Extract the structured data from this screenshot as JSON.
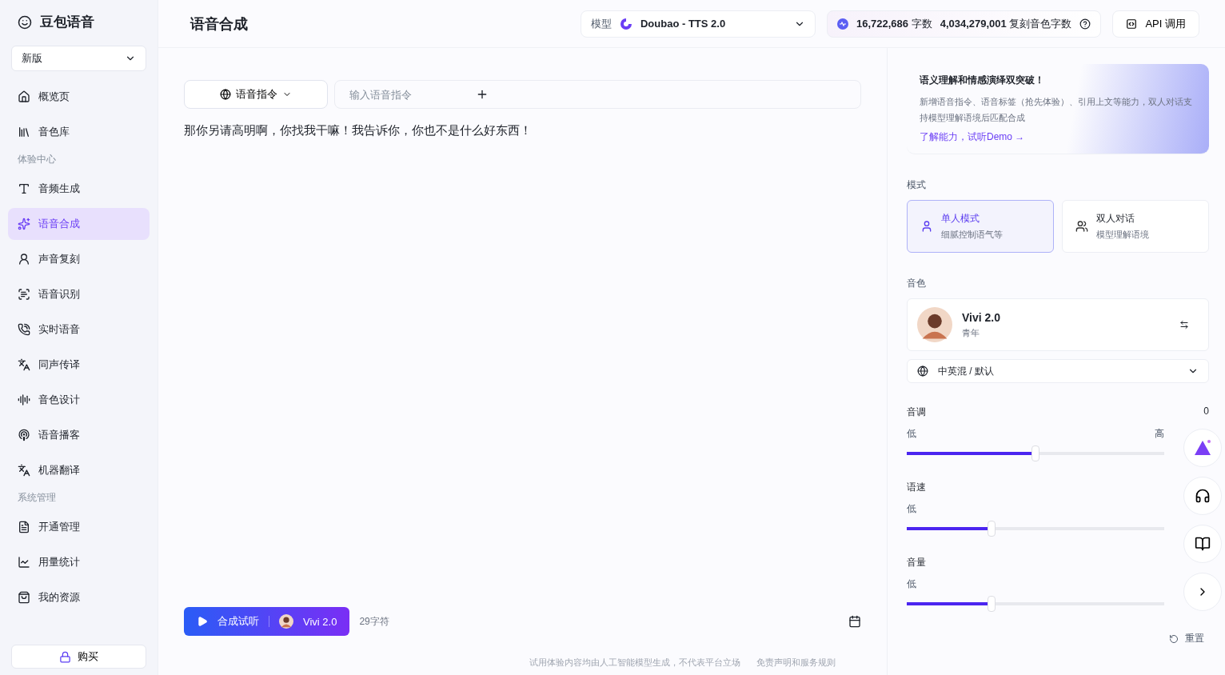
{
  "brand": {
    "name": "豆包语音"
  },
  "version_select": {
    "value": "新版"
  },
  "nav": [
    {
      "kind": "item",
      "label": "概览页",
      "selected": false
    },
    {
      "kind": "item",
      "label": "音色库",
      "selected": false
    },
    {
      "kind": "heading",
      "label": "体验中心"
    },
    {
      "kind": "item",
      "label": "音频生成",
      "selected": false
    },
    {
      "kind": "item",
      "label": "语音合成",
      "selected": true
    },
    {
      "kind": "item",
      "label": "声音复刻",
      "selected": false
    },
    {
      "kind": "item",
      "label": "语音识别",
      "selected": false
    },
    {
      "kind": "item",
      "label": "实时语音",
      "selected": false
    },
    {
      "kind": "item",
      "label": "同声传译",
      "selected": false
    },
    {
      "kind": "item",
      "label": "音色设计",
      "selected": false
    },
    {
      "kind": "item",
      "label": "语音播客",
      "selected": false
    },
    {
      "kind": "item",
      "label": "机器翻译",
      "selected": false
    },
    {
      "kind": "heading",
      "label": "系统管理"
    },
    {
      "kind": "item",
      "label": "开通管理",
      "selected": false
    },
    {
      "kind": "item",
      "label": "用量统计",
      "selected": false
    },
    {
      "kind": "item",
      "label": "我的资源",
      "selected": false
    }
  ],
  "buy_button": "购买",
  "page_title": "语音合成",
  "model_select": {
    "label": "模型",
    "value": "Doubao - TTS 2.0"
  },
  "quota": {
    "chars": "16,722,686",
    "chars_unit": "字数",
    "clone_chars": "4,034,279,001",
    "clone_unit": "复刻音色字数"
  },
  "api_button": "API 调用",
  "instruction_select": "语音指令",
  "instruction_input": {
    "placeholder": "输入语音指令"
  },
  "text_content": "那你另请高明啊，你找我干嘛！我告诉你，你也不是什么好东西！",
  "synth_button": {
    "label": "合成试听",
    "voice": "Vivi 2.0"
  },
  "char_count": "29字符",
  "footer": {
    "notice": "试用体验内容均由人工智能模型生成，不代表平台立场",
    "link": "免责声明和服务规则"
  },
  "promo": {
    "title": "语义理解和情感演绎双突破！",
    "body": "新增语音指令、语音标签（抢先体验）、引用上文等能力，双人对话支持模型理解语境后匹配合成",
    "link": "了解能力，试听Demo →"
  },
  "mode": {
    "label": "模式",
    "options": [
      {
        "title": "单人模式",
        "desc": "细腻控制语气等",
        "selected": true
      },
      {
        "title": "双人对话",
        "desc": "模型理解语境",
        "selected": false
      }
    ]
  },
  "voice": {
    "label": "音色",
    "name": "Vivi 2.0",
    "tag": "青年",
    "language": "中英混 / 默认"
  },
  "sliders": [
    {
      "label": "音调",
      "value": "0",
      "low": "低",
      "high": "高",
      "level": 0.5
    },
    {
      "label": "语速",
      "low": "低",
      "level": 0.33
    },
    {
      "label": "音量",
      "low": "低",
      "level": 0.33
    }
  ],
  "reset_button": "重置"
}
